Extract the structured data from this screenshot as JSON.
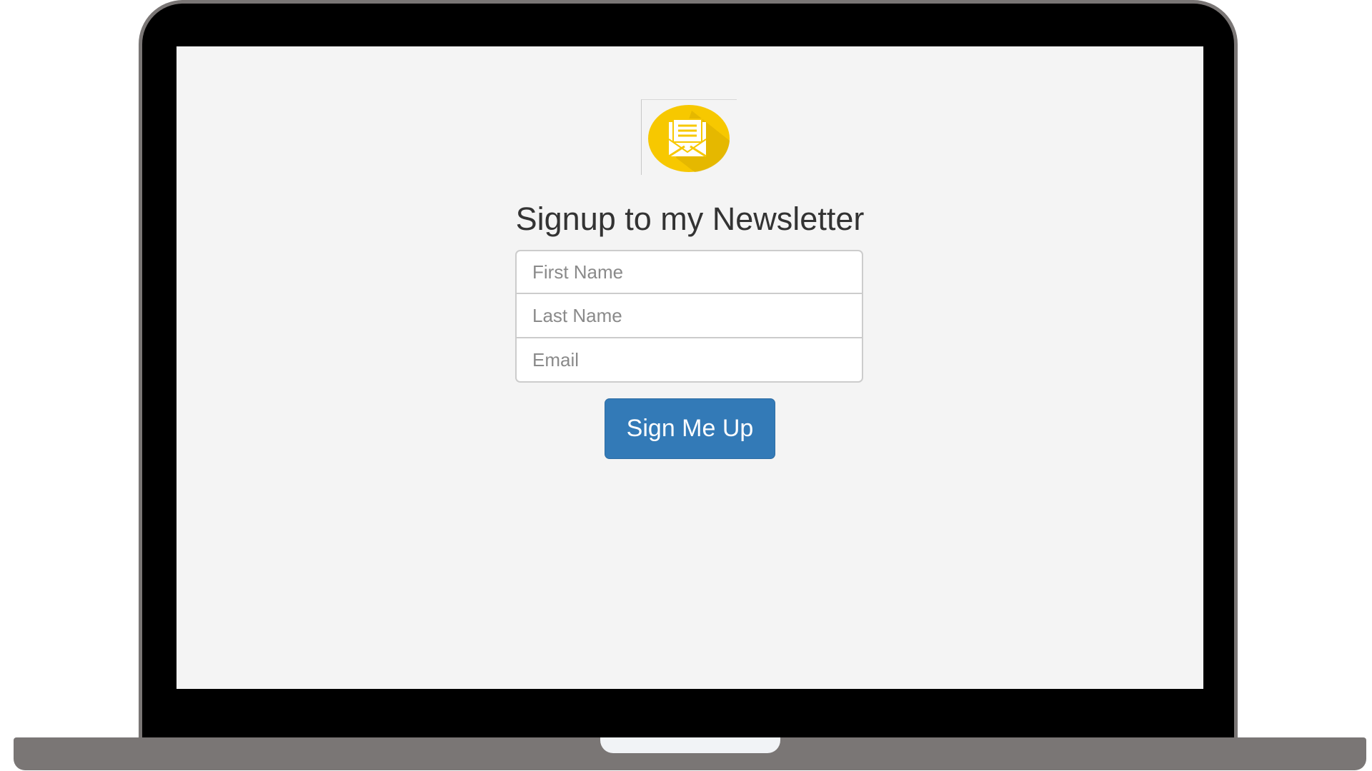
{
  "page": {
    "title": "Signup to my Newsletter",
    "logo_icon": "envelope-icon",
    "accent_color": "#337ab7",
    "logo_color": "#f7c800"
  },
  "form": {
    "first_name_placeholder": "First Name",
    "last_name_placeholder": "Last Name",
    "email_placeholder": "Email",
    "submit_label": "Sign Me Up"
  }
}
